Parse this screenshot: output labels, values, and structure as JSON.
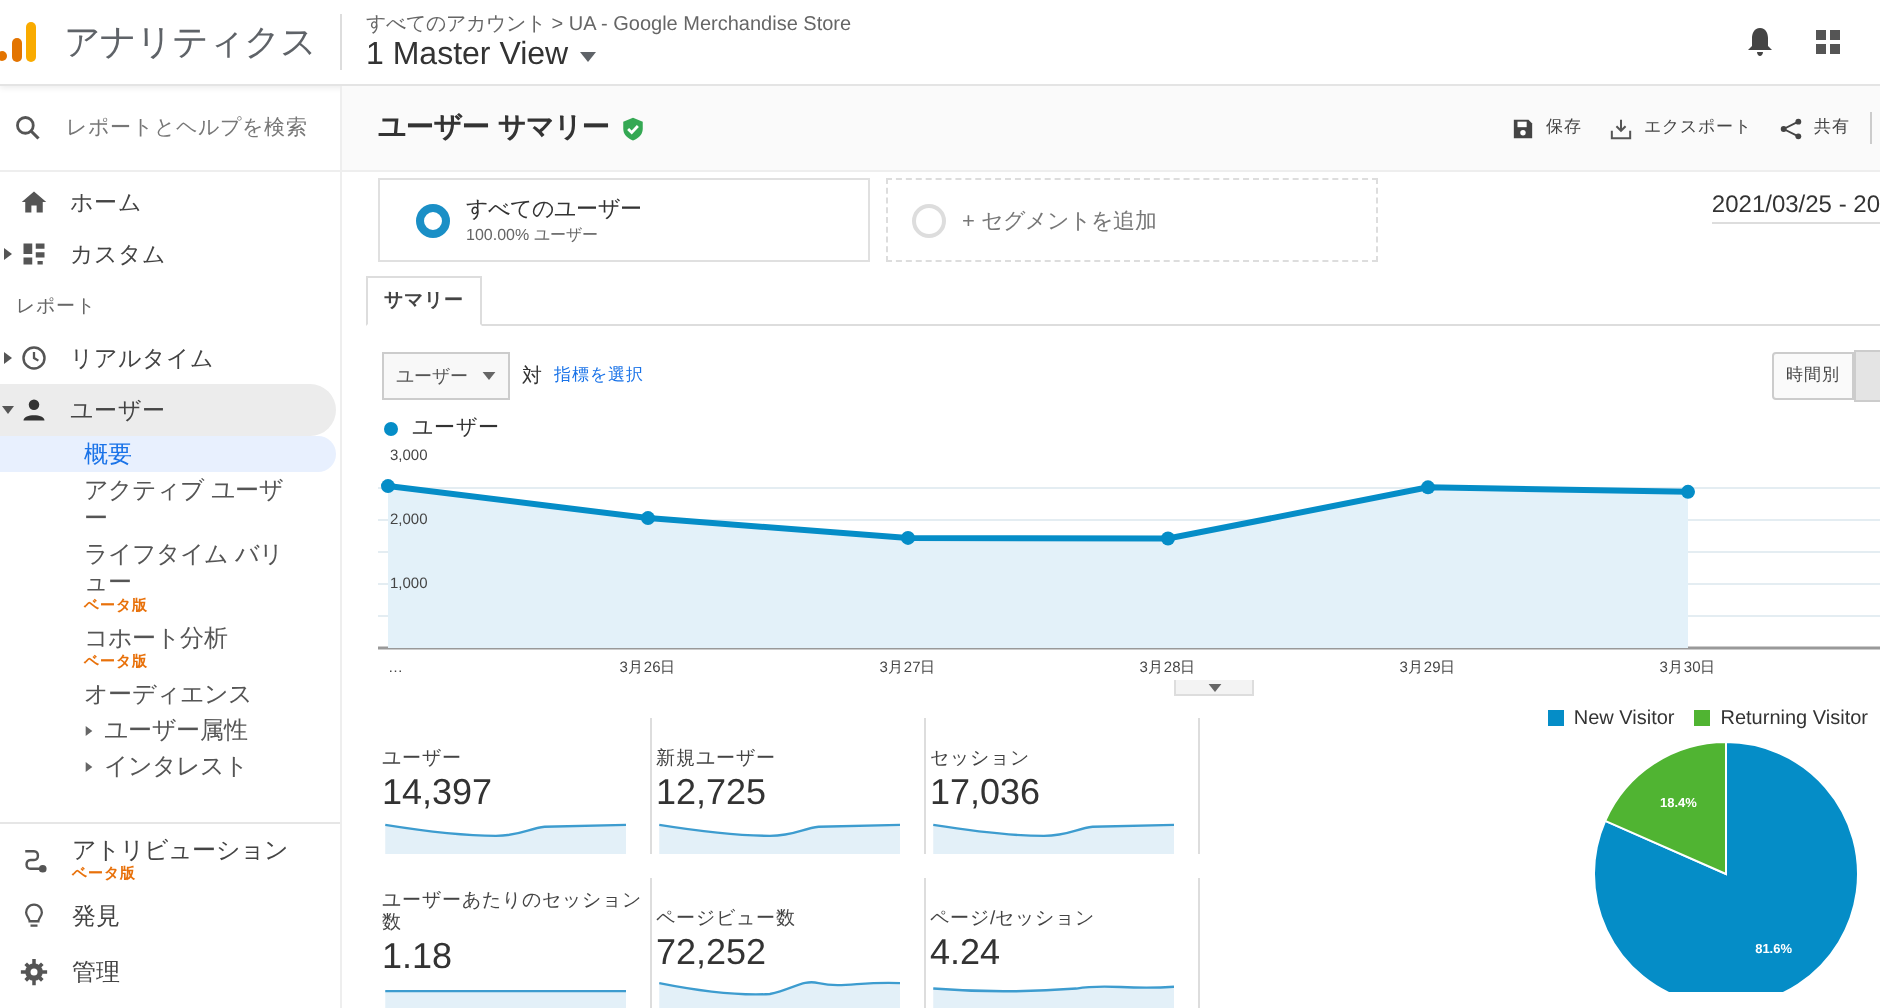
{
  "header": {
    "product": "アナリティクス",
    "breadcrumb": "すべてのアカウント > UA - Google Merchandise Store",
    "view": "1 Master View"
  },
  "search": {
    "placeholder": "レポートとヘルプを検索"
  },
  "nav": [
    {
      "kind": "link",
      "label": "ホーム",
      "selected": false
    },
    {
      "kind": "group",
      "label": "カスタム",
      "expanded": false,
      "selected": false
    },
    {
      "kind": "section",
      "label": "レポート"
    },
    {
      "kind": "group",
      "label": "リアルタイム",
      "expanded": false,
      "selected": false
    },
    {
      "kind": "group",
      "label": "ユーザー",
      "expanded": true,
      "selected": true,
      "children": [
        {
          "kind": "link",
          "label": "概要",
          "selected": true
        },
        {
          "kind": "link",
          "label": "アクティブ ユーザー",
          "selected": false
        },
        {
          "kind": "link",
          "label": "ライフタイム バリュー",
          "badge": "ベータ版",
          "selected": false
        },
        {
          "kind": "link",
          "label": "コホート分析",
          "badge": "ベータ版",
          "selected": false
        },
        {
          "kind": "link",
          "label": "オーディエンス",
          "selected": false
        },
        {
          "kind": "group",
          "label": "ユーザー属性",
          "expanded": false,
          "selected": false
        },
        {
          "kind": "group",
          "label": "インタレスト",
          "expanded": false,
          "selected": false
        }
      ]
    }
  ],
  "bottom_nav": [
    {
      "label": "アトリビューション",
      "badge": "ベータ版"
    },
    {
      "label": "発見"
    },
    {
      "label": "管理"
    }
  ],
  "report": {
    "title": "ユーザー サマリー",
    "verified": true,
    "actions": [
      "保存",
      "エクスポート",
      "共有"
    ]
  },
  "segments": [
    {
      "kind": "segment",
      "name": "すべてのユーザー",
      "detail": "100.00% ユーザー"
    },
    {
      "kind": "add",
      "name": "+ セグメントを追加"
    }
  ],
  "date_range": "2021/03/25 - 20",
  "tabs": [
    {
      "label": "サマリー",
      "selected": true
    }
  ],
  "metric_picker": {
    "value": "ユーザー",
    "versus": "対",
    "link": "指標を選択"
  },
  "granularity": [
    {
      "label": "時間別",
      "selected": false
    }
  ],
  "trend": {
    "chart_data": {
      "type": "area",
      "categories": [
        "…",
        "3月26日",
        "3月27日",
        "3月28日",
        "3月29日",
        "3月30日"
      ],
      "series": [
        {
          "name": "ユーザー",
          "color": "#058dc7",
          "values": [
            2530,
            2030,
            1720,
            1710,
            2510,
            2440
          ]
        }
      ],
      "ylim": [
        0,
        3000
      ],
      "yticks": [
        {
          "value": 1000,
          "label": "1,000"
        },
        {
          "value": 2000,
          "label": "2,000"
        },
        {
          "value": 3000,
          "label": "3,000"
        }
      ]
    }
  },
  "scorecards": [
    {
      "label": "ユーザー",
      "value": "14,397"
    },
    {
      "label": "新規ユーザー",
      "value": "12,725"
    },
    {
      "label": "セッション",
      "value": "17,036"
    },
    {
      "label": "ユーザーあたりのセッション数",
      "value": "1.18"
    },
    {
      "label": "ページビュー数",
      "value": "72,252"
    },
    {
      "label": "ページ/セッション",
      "value": "4.24"
    }
  ],
  "visitors": {
    "chart_data": {
      "type": "pie",
      "categories": [
        "New Visitor",
        "Returning Visitor"
      ],
      "colors": [
        "#058dc7",
        "#50b432"
      ],
      "values": [
        81.6,
        18.4
      ],
      "value_labels": [
        "81.6%",
        "18.4%"
      ]
    }
  }
}
